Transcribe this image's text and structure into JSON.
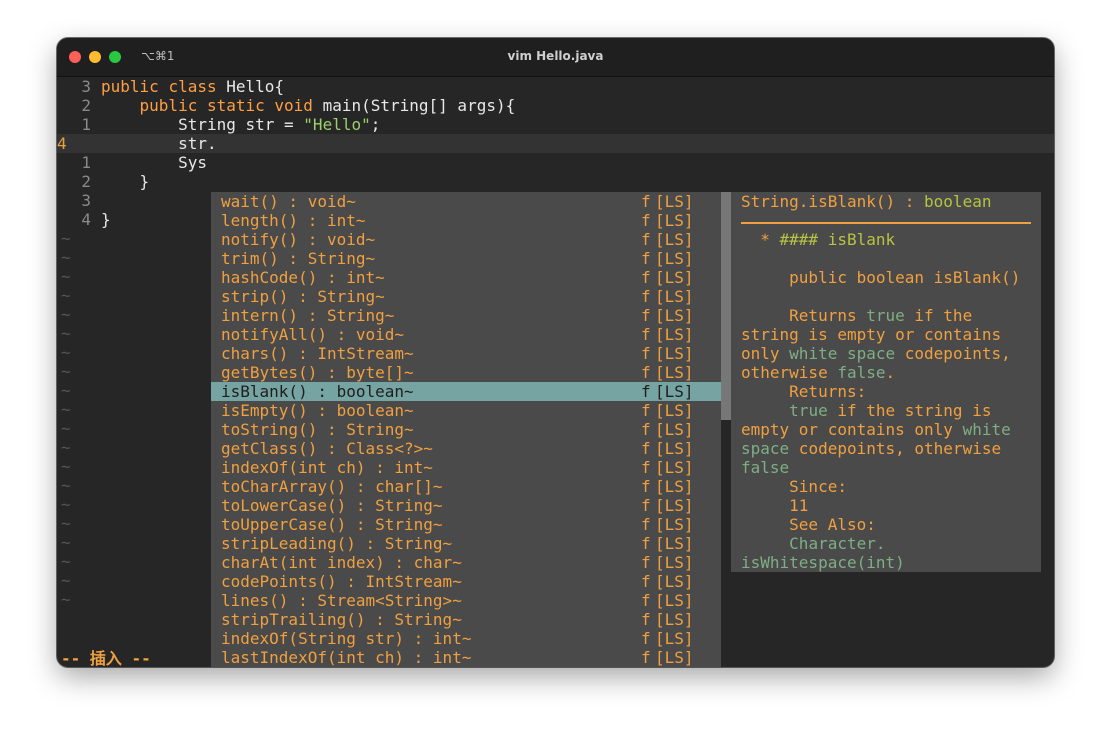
{
  "window": {
    "shortcut": "⌥⌘1",
    "title": "vim Hello.java",
    "traffic_lights": [
      "#fe5f57",
      "#febc2e",
      "#28c840"
    ]
  },
  "editor": {
    "lines": [
      {
        "nr": "3",
        "current": false,
        "tokens": [
          {
            "t": "public",
            "c": "kw"
          },
          {
            "t": " "
          },
          {
            "t": "class",
            "c": "kw"
          },
          {
            "t": " Hello{"
          }
        ]
      },
      {
        "nr": "2",
        "current": false,
        "tokens": [
          {
            "t": "    "
          },
          {
            "t": "public",
            "c": "kw"
          },
          {
            "t": " "
          },
          {
            "t": "static",
            "c": "kw"
          },
          {
            "t": " "
          },
          {
            "t": "void",
            "c": "kw"
          },
          {
            "t": " main(String[] args){"
          }
        ]
      },
      {
        "nr": "1",
        "current": false,
        "tokens": [
          {
            "t": "        String str = "
          },
          {
            "t": "\"Hello\"",
            "c": "str"
          },
          {
            "t": ";"
          }
        ]
      },
      {
        "nr": "4",
        "current": true,
        "tokens": [
          {
            "t": "        str."
          }
        ]
      },
      {
        "nr": "1",
        "current": false,
        "tokens": [
          {
            "t": "        Sys"
          }
        ]
      },
      {
        "nr": "2",
        "current": false,
        "tokens": [
          {
            "t": "    }"
          }
        ]
      },
      {
        "nr": "3",
        "current": false,
        "tokens": []
      },
      {
        "nr": "4",
        "current": false,
        "tokens": [
          {
            "t": "}"
          }
        ]
      }
    ],
    "tilde_char": "~",
    "tilde_count": 20,
    "mode_text": "-- 插入 --"
  },
  "completion": {
    "items": [
      {
        "abbr": "wait() : void~",
        "kind": "f",
        "menu": "[LS]"
      },
      {
        "abbr": "length() : int~",
        "kind": "f",
        "menu": "[LS]"
      },
      {
        "abbr": "notify() : void~",
        "kind": "f",
        "menu": "[LS]"
      },
      {
        "abbr": "trim() : String~",
        "kind": "f",
        "menu": "[LS]"
      },
      {
        "abbr": "hashCode() : int~",
        "kind": "f",
        "menu": "[LS]"
      },
      {
        "abbr": "strip() : String~",
        "kind": "f",
        "menu": "[LS]"
      },
      {
        "abbr": "intern() : String~",
        "kind": "f",
        "menu": "[LS]"
      },
      {
        "abbr": "notifyAll() : void~",
        "kind": "f",
        "menu": "[LS]"
      },
      {
        "abbr": "chars() : IntStream~",
        "kind": "f",
        "menu": "[LS]"
      },
      {
        "abbr": "getBytes() : byte[]~",
        "kind": "f",
        "menu": "[LS]"
      },
      {
        "abbr": "isBlank() : boolean~",
        "kind": "f",
        "menu": "[LS]",
        "selected": true
      },
      {
        "abbr": "isEmpty() : boolean~",
        "kind": "f",
        "menu": "[LS]"
      },
      {
        "abbr": "toString() : String~",
        "kind": "f",
        "menu": "[LS]"
      },
      {
        "abbr": "getClass() : Class<?>~",
        "kind": "f",
        "menu": "[LS]"
      },
      {
        "abbr": "indexOf(int ch) : int~",
        "kind": "f",
        "menu": "[LS]"
      },
      {
        "abbr": "toCharArray() : char[]~",
        "kind": "f",
        "menu": "[LS]"
      },
      {
        "abbr": "toLowerCase() : String~",
        "kind": "f",
        "menu": "[LS]"
      },
      {
        "abbr": "toUpperCase() : String~",
        "kind": "f",
        "menu": "[LS]"
      },
      {
        "abbr": "stripLeading() : String~",
        "kind": "f",
        "menu": "[LS]"
      },
      {
        "abbr": "charAt(int index) : char~",
        "kind": "f",
        "menu": "[LS]"
      },
      {
        "abbr": "codePoints() : IntStream~",
        "kind": "f",
        "menu": "[LS]"
      },
      {
        "abbr": "lines() : Stream<String>~",
        "kind": "f",
        "menu": "[LS]"
      },
      {
        "abbr": "stripTrailing() : String~",
        "kind": "f",
        "menu": "[LS]"
      },
      {
        "abbr": "indexOf(String str) : int~",
        "kind": "f",
        "menu": "[LS]"
      },
      {
        "abbr": "lastIndexOf(int ch) : int~",
        "kind": "f",
        "menu": "[LS]"
      }
    ],
    "selected_bg": "#76a4a2"
  },
  "doc": {
    "lines": [
      [
        {
          "t": "String.isBlank() : "
        },
        {
          "t": "boolean",
          "c": "ok"
        }
      ],
      [],
      [
        {
          "t": "  * "
        },
        {
          "t": "#### isBlank",
          "c": "ok"
        }
      ],
      [],
      [
        {
          "t": "     public boolean isBlank()"
        }
      ],
      [],
      [
        {
          "t": "     Returns "
        },
        {
          "t": "true",
          "c": "g"
        },
        {
          "t": " if the"
        }
      ],
      [
        {
          "t": "string is empty or contains"
        }
      ],
      [
        {
          "t": "only "
        },
        {
          "t": "white space",
          "c": "g"
        },
        {
          "t": " codepoints,"
        }
      ],
      [
        {
          "t": "otherwise "
        },
        {
          "t": "false",
          "c": "g"
        },
        {
          "t": "."
        }
      ],
      [
        {
          "t": "     Returns:"
        }
      ],
      [
        {
          "t": "     "
        },
        {
          "t": "true",
          "c": "g"
        },
        {
          "t": " if the string is"
        }
      ],
      [
        {
          "t": "empty or contains only "
        },
        {
          "t": "white",
          "c": "g"
        }
      ],
      [
        {
          "t": "space",
          "c": "g"
        },
        {
          "t": " codepoints, otherwise"
        }
      ],
      [
        {
          "t": "false",
          "c": "g"
        }
      ],
      [
        {
          "t": "     Since:"
        }
      ],
      [
        {
          "t": "     11"
        }
      ],
      [
        {
          "t": "     See Also:"
        }
      ],
      [
        {
          "t": "     "
        },
        {
          "t": "Character.",
          "c": "g"
        }
      ],
      [
        {
          "t": "isWhitespace(int)",
          "c": "g"
        }
      ]
    ]
  }
}
